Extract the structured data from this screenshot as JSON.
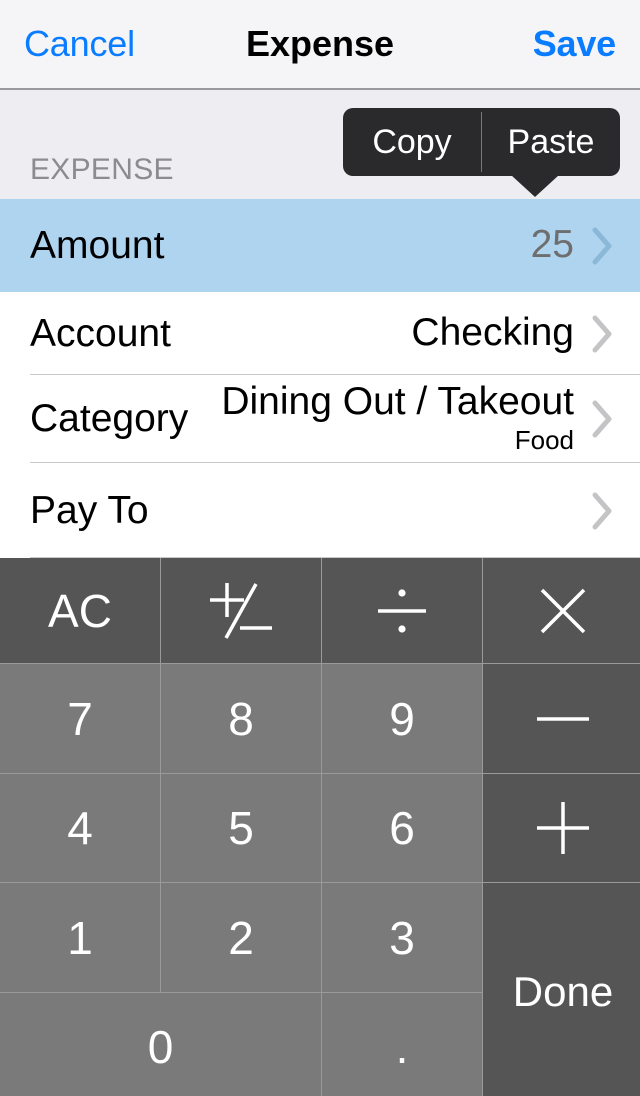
{
  "navbar": {
    "cancel_label": "Cancel",
    "title": "Expense",
    "save_label": "Save"
  },
  "edit_popup": {
    "copy_label": "Copy",
    "paste_label": "Paste"
  },
  "form": {
    "section_header": "EXPENSE",
    "rows": [
      {
        "title": "Amount",
        "value": "25",
        "subvalue": "",
        "selected": true
      },
      {
        "title": "Account",
        "value": "Checking",
        "subvalue": "",
        "selected": false
      },
      {
        "title": "Category",
        "value": "Dining Out / Takeout",
        "subvalue": "Food",
        "selected": false
      },
      {
        "title": "Pay To",
        "value": "",
        "subvalue": "",
        "selected": false
      }
    ]
  },
  "keypad": {
    "keys": {
      "clear": "AC",
      "sign": "+/-",
      "divide": "÷",
      "multiply": "×",
      "seven": "7",
      "eight": "8",
      "nine": "9",
      "minus": "—",
      "four": "4",
      "five": "5",
      "six": "6",
      "plus": "+",
      "one": "1",
      "two": "2",
      "three": "3",
      "done": "Done",
      "zero": "0",
      "decimal": "."
    }
  },
  "colors": {
    "accent_blue": "#0a7cff",
    "selected_row": "#aed4f0",
    "navbar_bg": "#f5f5f7",
    "section_bg": "#eeeef2",
    "key_number": "#7a7a7a",
    "key_operator": "#555556",
    "popup_bg": "#2a2a2c"
  }
}
